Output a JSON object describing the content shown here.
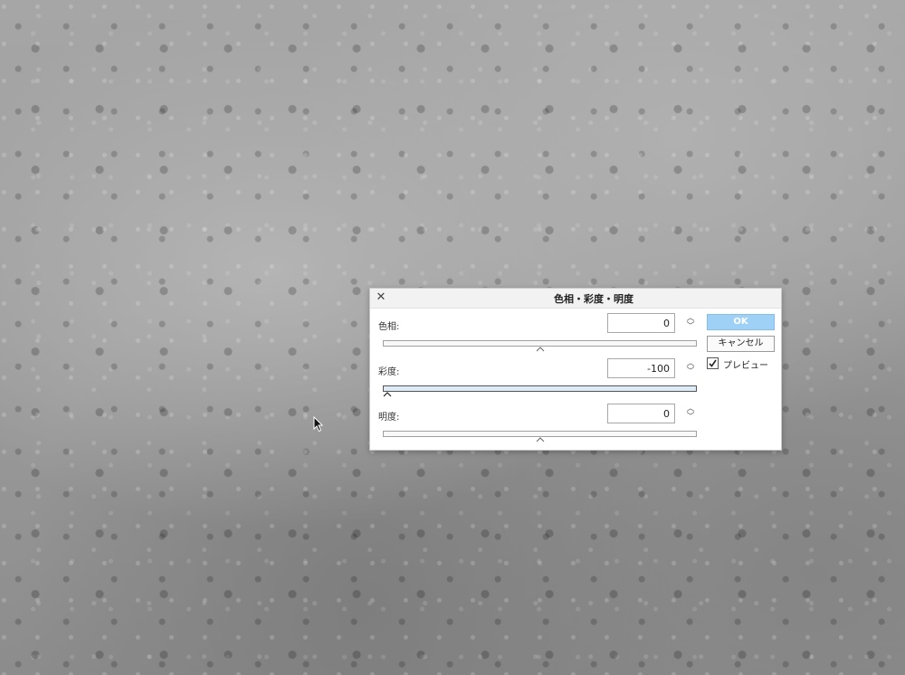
{
  "dialog": {
    "title": "色相・彩度・明度",
    "fields": [
      {
        "label": "色相:",
        "value": "0",
        "slider_fraction": 0.5
      },
      {
        "label": "彩度:",
        "value": "-100",
        "slider_fraction": 0.0
      },
      {
        "label": "明度:",
        "value": "0",
        "slider_fraction": 0.5
      }
    ],
    "ok_label": "OK",
    "cancel_label": "キャンセル",
    "preview_label": "プレビュー",
    "preview_checked": true
  },
  "colors": {
    "ok_button": "#9fd1f7",
    "active_track": "#dfeaf7"
  },
  "icons": {
    "close": "close-icon",
    "stepper": "chevron-up-down-icon",
    "check": "checkmark-icon",
    "cursor": "mouse-pointer-icon"
  }
}
